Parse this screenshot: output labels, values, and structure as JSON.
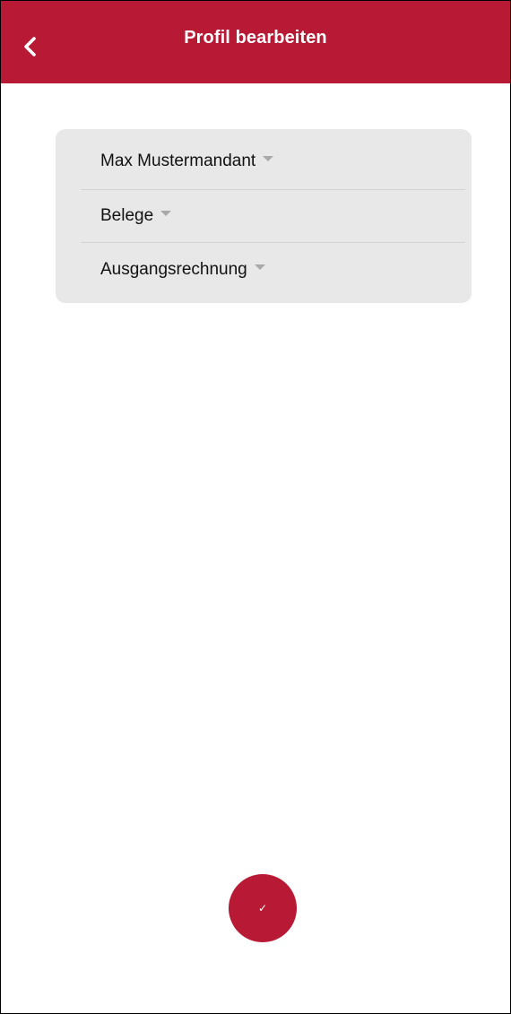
{
  "header": {
    "title": "Profil bearbeiten",
    "back_icon": "chevron-left-icon",
    "background_color": "#b81a35"
  },
  "selectors": [
    {
      "label": "Max Mustermandant",
      "icon": "caret-down-icon"
    },
    {
      "label": "Belege",
      "icon": "caret-down-icon"
    },
    {
      "label": "Ausgangsrechnung",
      "icon": "caret-down-icon"
    }
  ],
  "fab": {
    "icon": "checkmark-icon",
    "glyph": "✓",
    "color": "#b81a35"
  }
}
